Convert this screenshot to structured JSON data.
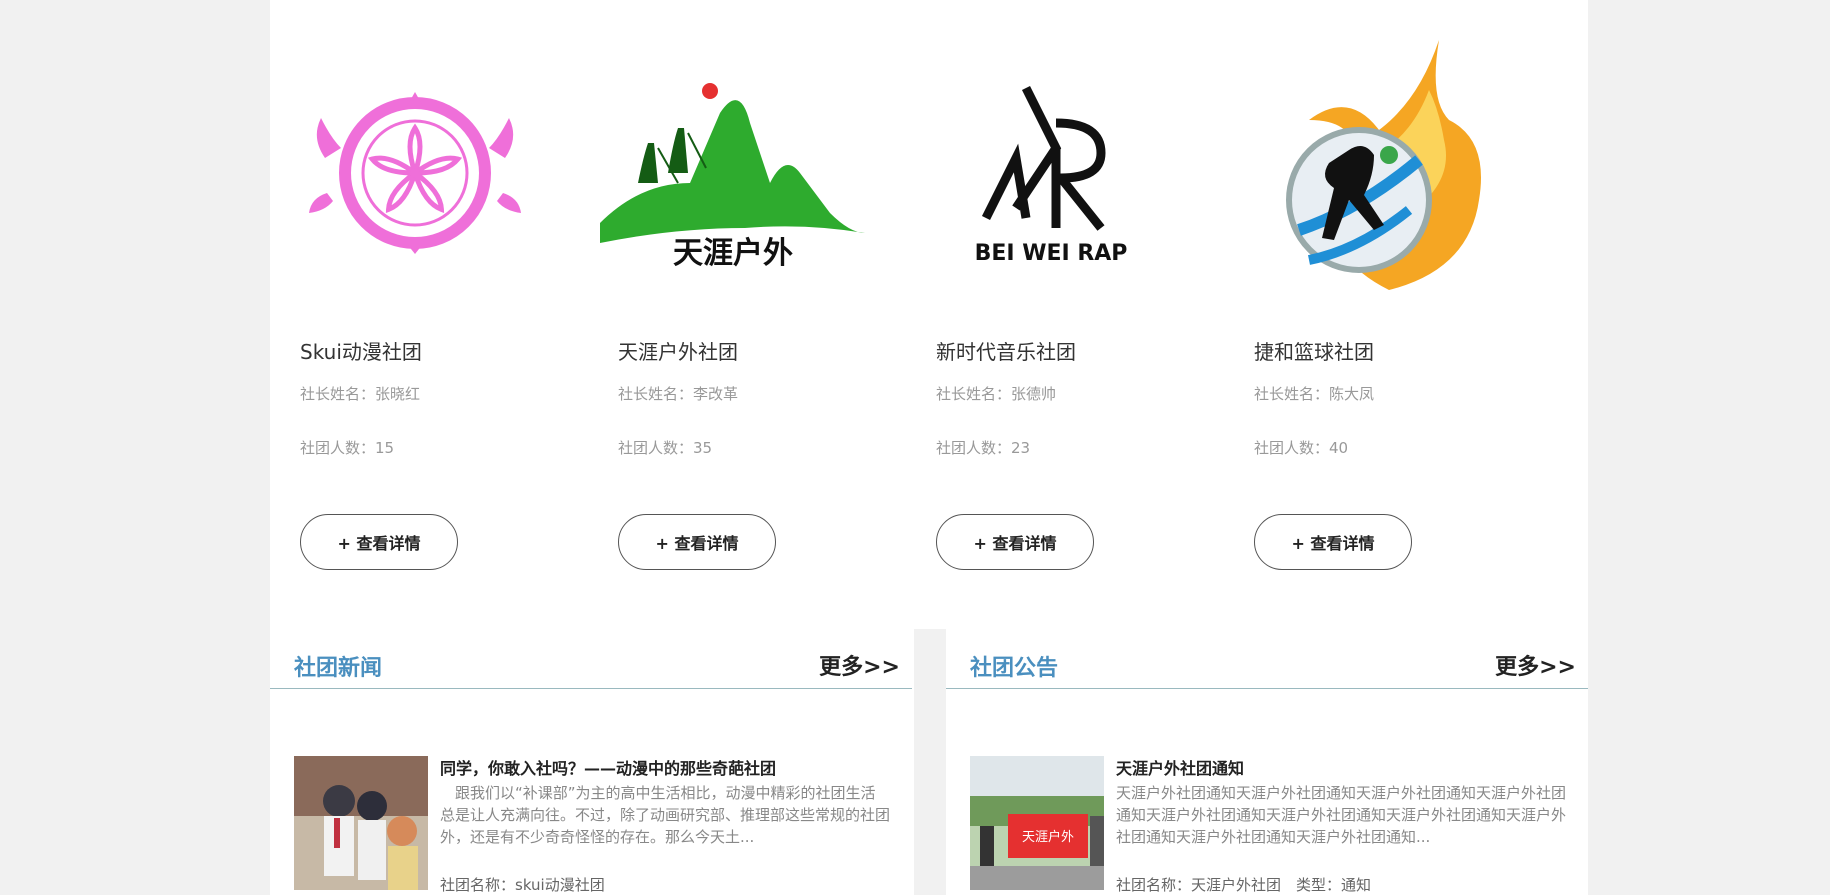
{
  "clubs": [
    {
      "name": "Skui动漫社团",
      "leader": "社长姓名：张晓红",
      "count": "社团人数：15",
      "button": "+ 查看详情",
      "icon": "sakura-crest-logo"
    },
    {
      "name": "天涯户外社团",
      "leader": "社长姓名：李改革",
      "count": "社团人数：35",
      "button": "+ 查看详情",
      "icon": "mountain-hikers-logo",
      "logo_text": "天涯户外"
    },
    {
      "name": "新时代音乐社团",
      "leader": "社长姓名：张德帅",
      "count": "社团人数：23",
      "button": "+ 查看详情",
      "icon": "bei-wei-rap-logo",
      "logo_text": "BEI WEI RAP"
    },
    {
      "name": "捷和篮球社团",
      "leader": "社长姓名：陈大凤",
      "count": "社团人数：40",
      "button": "+ 查看详情",
      "icon": "flaming-basketball-logo"
    }
  ],
  "news": {
    "title": "社团新闻",
    "more": "更多>>",
    "item": {
      "title": "同学，你敢入社吗？——动漫中的那些奇葩社团",
      "body": "　跟我们以“补课部”为主的高中生活相比，动漫中精彩的社团生活总是让人充满向往。不过，除了动画研究部、推理部这些常规的社团外，还是有不少奇奇怪怪的存在。那么今天土...",
      "meta": "社团名称：skui动漫社团"
    }
  },
  "notice": {
    "title": "社团公告",
    "more": "更多>>",
    "item": {
      "title": "天涯户外社团通知",
      "body": "天涯户外社团通知天涯户外社团通知天涯户外社团通知天涯户外社团通知天涯户外社团通知天涯户外社团通知天涯户外社团通知天涯户外社团通知天涯户外社团通知天涯户外社团通知...",
      "meta": "社团名称：天涯户外社团　类型：通知",
      "banner_text": "天涯户外"
    }
  },
  "colors": {
    "accent": "#4a8fbf",
    "pink": "#ef6fd9",
    "green": "#2eab2e",
    "red": "#e53030",
    "orange": "#f5a623"
  }
}
